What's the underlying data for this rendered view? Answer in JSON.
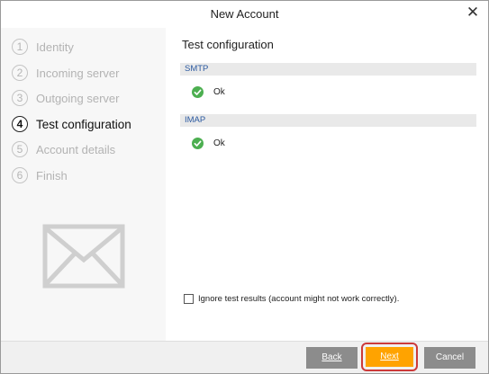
{
  "window": {
    "title": "New Account",
    "close_glyph": "✕"
  },
  "steps": [
    {
      "number": "1",
      "label": "Identity",
      "active": false
    },
    {
      "number": "2",
      "label": "Incoming server",
      "active": false
    },
    {
      "number": "3",
      "label": "Outgoing server",
      "active": false
    },
    {
      "number": "4",
      "label": "Test configuration",
      "active": true
    },
    {
      "number": "5",
      "label": "Account details",
      "active": false
    },
    {
      "number": "6",
      "label": "Finish",
      "active": false
    }
  ],
  "main": {
    "section_title": "Test configuration",
    "groups": [
      {
        "header": "SMTP",
        "status": "Ok",
        "status_icon": "check-circle-icon"
      },
      {
        "header": "IMAP",
        "status": "Ok",
        "status_icon": "check-circle-icon"
      }
    ],
    "ignore_checkbox": {
      "checked": false,
      "label": "Ignore test results (account might not work correctly)."
    }
  },
  "footer": {
    "back_label": "Back",
    "next_label": "Next",
    "cancel_label": "Cancel"
  },
  "colors": {
    "accent_next": "#ffa300",
    "highlight_outline": "#cc3a3a",
    "ok_green": "#4caf50",
    "group_header_text": "#2c5aa0",
    "button_gray": "#8c8c8c"
  }
}
